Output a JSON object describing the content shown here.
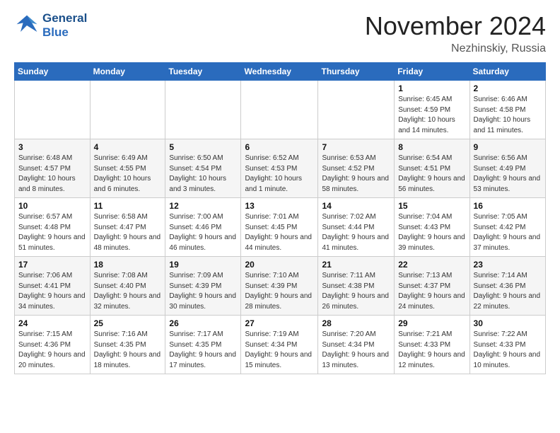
{
  "header": {
    "logo_line1": "General",
    "logo_line2": "Blue",
    "month": "November 2024",
    "location": "Nezhinskiy, Russia"
  },
  "weekdays": [
    "Sunday",
    "Monday",
    "Tuesday",
    "Wednesday",
    "Thursday",
    "Friday",
    "Saturday"
  ],
  "weeks": [
    [
      {
        "day": "",
        "info": ""
      },
      {
        "day": "",
        "info": ""
      },
      {
        "day": "",
        "info": ""
      },
      {
        "day": "",
        "info": ""
      },
      {
        "day": "",
        "info": ""
      },
      {
        "day": "1",
        "info": "Sunrise: 6:45 AM\nSunset: 4:59 PM\nDaylight: 10 hours and 14 minutes."
      },
      {
        "day": "2",
        "info": "Sunrise: 6:46 AM\nSunset: 4:58 PM\nDaylight: 10 hours and 11 minutes."
      }
    ],
    [
      {
        "day": "3",
        "info": "Sunrise: 6:48 AM\nSunset: 4:57 PM\nDaylight: 10 hours and 8 minutes."
      },
      {
        "day": "4",
        "info": "Sunrise: 6:49 AM\nSunset: 4:55 PM\nDaylight: 10 hours and 6 minutes."
      },
      {
        "day": "5",
        "info": "Sunrise: 6:50 AM\nSunset: 4:54 PM\nDaylight: 10 hours and 3 minutes."
      },
      {
        "day": "6",
        "info": "Sunrise: 6:52 AM\nSunset: 4:53 PM\nDaylight: 10 hours and 1 minute."
      },
      {
        "day": "7",
        "info": "Sunrise: 6:53 AM\nSunset: 4:52 PM\nDaylight: 9 hours and 58 minutes."
      },
      {
        "day": "8",
        "info": "Sunrise: 6:54 AM\nSunset: 4:51 PM\nDaylight: 9 hours and 56 minutes."
      },
      {
        "day": "9",
        "info": "Sunrise: 6:56 AM\nSunset: 4:49 PM\nDaylight: 9 hours and 53 minutes."
      }
    ],
    [
      {
        "day": "10",
        "info": "Sunrise: 6:57 AM\nSunset: 4:48 PM\nDaylight: 9 hours and 51 minutes."
      },
      {
        "day": "11",
        "info": "Sunrise: 6:58 AM\nSunset: 4:47 PM\nDaylight: 9 hours and 48 minutes."
      },
      {
        "day": "12",
        "info": "Sunrise: 7:00 AM\nSunset: 4:46 PM\nDaylight: 9 hours and 46 minutes."
      },
      {
        "day": "13",
        "info": "Sunrise: 7:01 AM\nSunset: 4:45 PM\nDaylight: 9 hours and 44 minutes."
      },
      {
        "day": "14",
        "info": "Sunrise: 7:02 AM\nSunset: 4:44 PM\nDaylight: 9 hours and 41 minutes."
      },
      {
        "day": "15",
        "info": "Sunrise: 7:04 AM\nSunset: 4:43 PM\nDaylight: 9 hours and 39 minutes."
      },
      {
        "day": "16",
        "info": "Sunrise: 7:05 AM\nSunset: 4:42 PM\nDaylight: 9 hours and 37 minutes."
      }
    ],
    [
      {
        "day": "17",
        "info": "Sunrise: 7:06 AM\nSunset: 4:41 PM\nDaylight: 9 hours and 34 minutes."
      },
      {
        "day": "18",
        "info": "Sunrise: 7:08 AM\nSunset: 4:40 PM\nDaylight: 9 hours and 32 minutes."
      },
      {
        "day": "19",
        "info": "Sunrise: 7:09 AM\nSunset: 4:39 PM\nDaylight: 9 hours and 30 minutes."
      },
      {
        "day": "20",
        "info": "Sunrise: 7:10 AM\nSunset: 4:39 PM\nDaylight: 9 hours and 28 minutes."
      },
      {
        "day": "21",
        "info": "Sunrise: 7:11 AM\nSunset: 4:38 PM\nDaylight: 9 hours and 26 minutes."
      },
      {
        "day": "22",
        "info": "Sunrise: 7:13 AM\nSunset: 4:37 PM\nDaylight: 9 hours and 24 minutes."
      },
      {
        "day": "23",
        "info": "Sunrise: 7:14 AM\nSunset: 4:36 PM\nDaylight: 9 hours and 22 minutes."
      }
    ],
    [
      {
        "day": "24",
        "info": "Sunrise: 7:15 AM\nSunset: 4:36 PM\nDaylight: 9 hours and 20 minutes."
      },
      {
        "day": "25",
        "info": "Sunrise: 7:16 AM\nSunset: 4:35 PM\nDaylight: 9 hours and 18 minutes."
      },
      {
        "day": "26",
        "info": "Sunrise: 7:17 AM\nSunset: 4:35 PM\nDaylight: 9 hours and 17 minutes."
      },
      {
        "day": "27",
        "info": "Sunrise: 7:19 AM\nSunset: 4:34 PM\nDaylight: 9 hours and 15 minutes."
      },
      {
        "day": "28",
        "info": "Sunrise: 7:20 AM\nSunset: 4:34 PM\nDaylight: 9 hours and 13 minutes."
      },
      {
        "day": "29",
        "info": "Sunrise: 7:21 AM\nSunset: 4:33 PM\nDaylight: 9 hours and 12 minutes."
      },
      {
        "day": "30",
        "info": "Sunrise: 7:22 AM\nSunset: 4:33 PM\nDaylight: 9 hours and 10 minutes."
      }
    ]
  ]
}
